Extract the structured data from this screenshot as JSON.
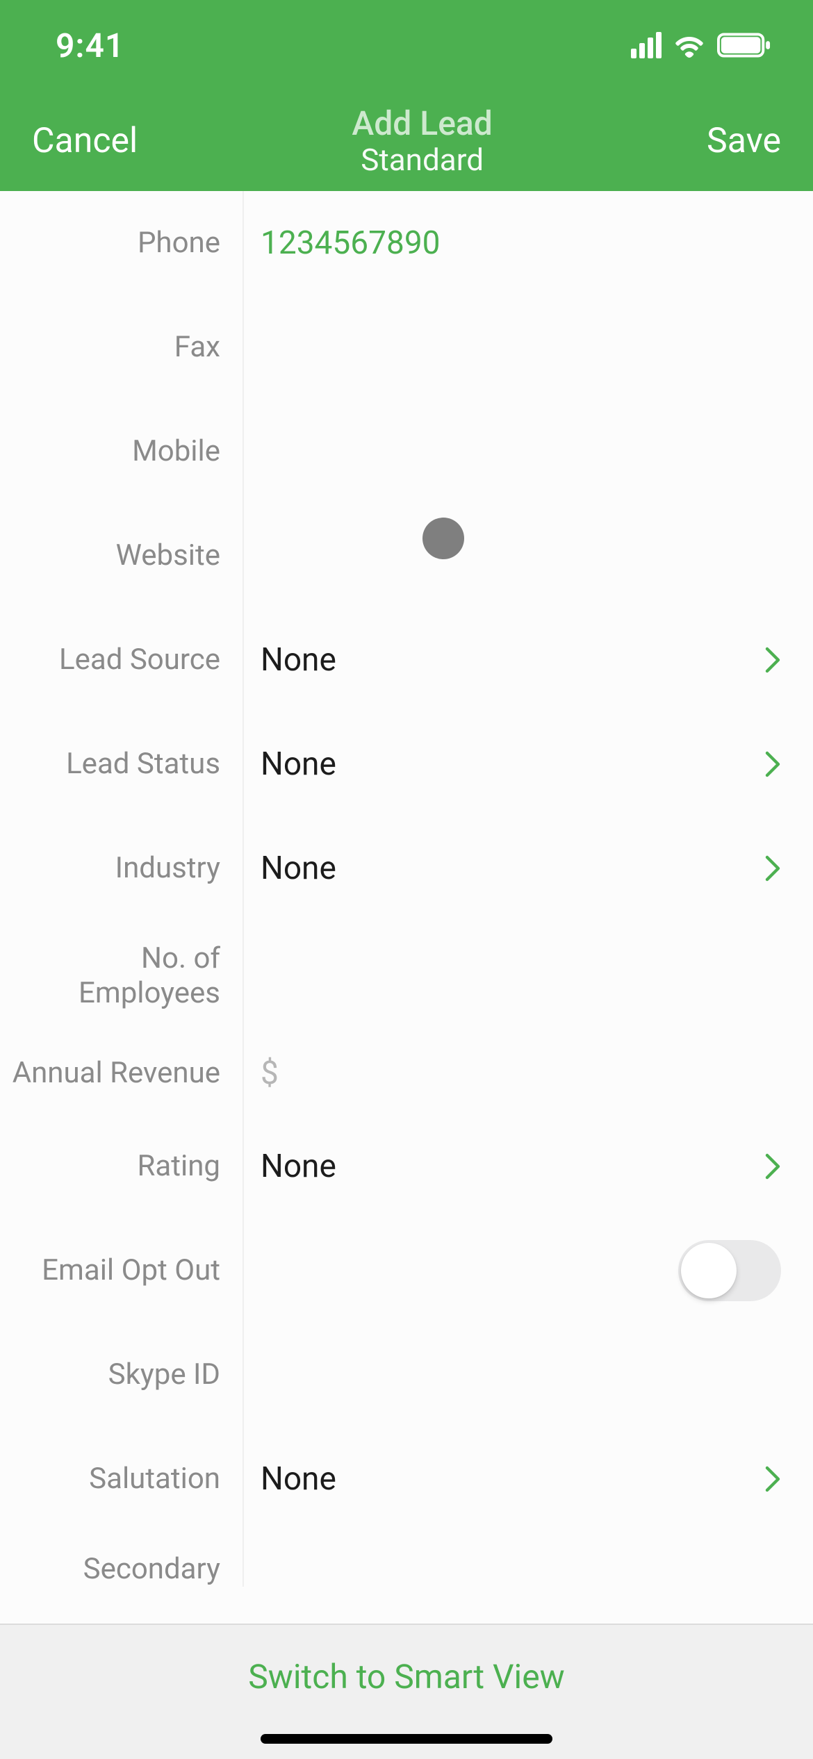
{
  "status": {
    "time": "9:41"
  },
  "nav": {
    "cancel": "Cancel",
    "title": "Add Lead",
    "subtitle": "Standard",
    "save": "Save"
  },
  "fields": {
    "phone": {
      "label": "Phone",
      "value": "1234567890"
    },
    "fax": {
      "label": "Fax",
      "value": ""
    },
    "mobile": {
      "label": "Mobile",
      "value": ""
    },
    "website": {
      "label": "Website",
      "value": ""
    },
    "lead_source": {
      "label": "Lead Source",
      "value": "None"
    },
    "lead_status": {
      "label": "Lead Status",
      "value": "None"
    },
    "industry": {
      "label": "Industry",
      "value": "None"
    },
    "employees": {
      "label": "No. of Employees",
      "value": ""
    },
    "revenue": {
      "label": "Annual Revenue",
      "placeholder": "$"
    },
    "rating": {
      "label": "Rating",
      "value": "None"
    },
    "email_opt_out": {
      "label": "Email Opt Out",
      "value": false
    },
    "skype": {
      "label": "Skype ID",
      "value": ""
    },
    "salutation": {
      "label": "Salutation",
      "value": "None"
    },
    "secondary": {
      "label": "Secondary",
      "value": ""
    }
  },
  "footer": {
    "smart_view": "Switch to Smart View"
  }
}
